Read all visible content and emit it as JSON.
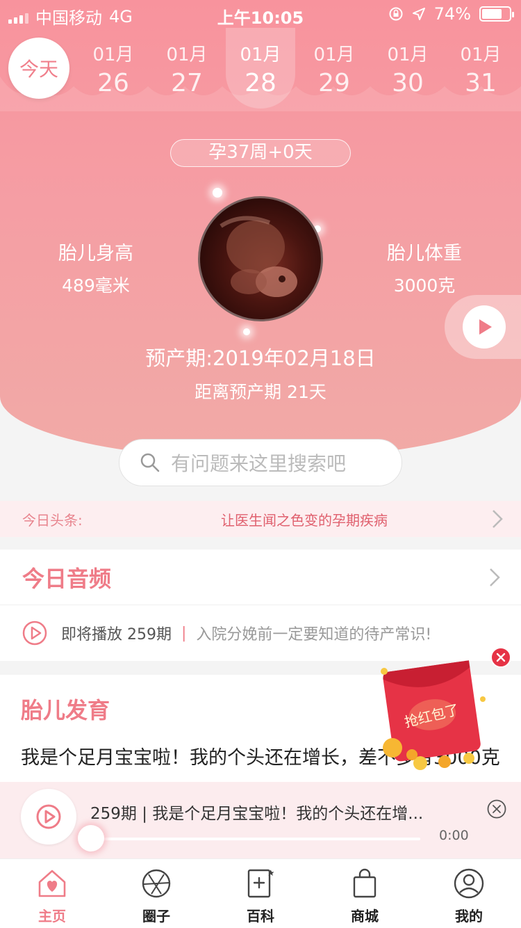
{
  "status_bar": {
    "carrier": "中国移动",
    "network": "4G",
    "time": "上午10:05",
    "battery": "74%",
    "battery_level": 0.74
  },
  "date_strip": {
    "today_label": "今天",
    "dates": [
      {
        "month": "01月",
        "day": "26"
      },
      {
        "month": "01月",
        "day": "27"
      },
      {
        "month": "01月",
        "day": "28",
        "active": true
      },
      {
        "month": "01月",
        "day": "29"
      },
      {
        "month": "01月",
        "day": "30"
      },
      {
        "month": "01月",
        "day": "31"
      }
    ]
  },
  "pregnancy": {
    "week": "孕37周+0天",
    "height_label": "胎儿身高",
    "height_value": "489毫米",
    "weight_label": "胎儿体重",
    "weight_value": "3000克",
    "due_date": "预产期:2019年02月18日",
    "countdown": "距离预产期 21天"
  },
  "search": {
    "placeholder": "有问题来这里搜索吧"
  },
  "headline": {
    "tag": "今日头条:",
    "title": "让医生闻之色变的孕期疾病"
  },
  "audio": {
    "title": "今日音频",
    "upcoming": "即将播放 259期",
    "separator": "|",
    "description": "入院分娩前一定要知道的待产常识!"
  },
  "development": {
    "title": "胎儿发育",
    "text": "我是个足月宝宝啦！我的个头还在增长，差不多有3000克啦！妈妈，我很快就要出来啦，一起加油吧！"
  },
  "player": {
    "title": "259期 | 我是个足月宝宝啦！我的个头还在增...",
    "time": "0:00",
    "progress": 0
  },
  "red_packet": {
    "label": "抢红包了"
  },
  "tabs": [
    {
      "label": "主页",
      "icon": "home-heart-icon",
      "active": true
    },
    {
      "label": "圈子",
      "icon": "circle-aperture-icon"
    },
    {
      "label": "百科",
      "icon": "book-plus-icon"
    },
    {
      "label": "商城",
      "icon": "shopping-bag-icon"
    },
    {
      "label": "我的",
      "icon": "user-icon"
    }
  ],
  "colors": {
    "accent": "#ef7c88",
    "hero_top": "#f8939d",
    "hero_bottom": "#f1aaa6",
    "red_packet": "#e63346"
  }
}
